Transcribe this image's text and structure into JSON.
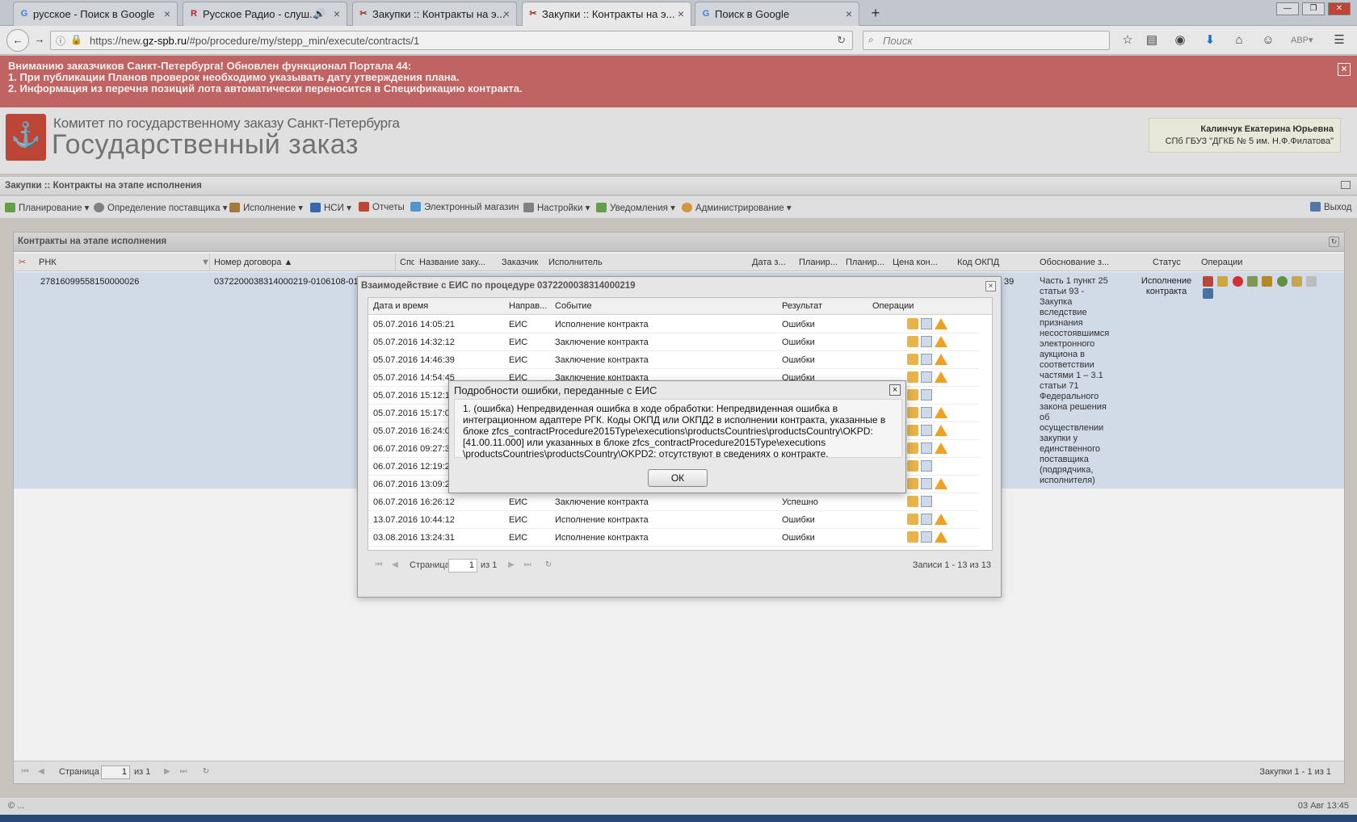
{
  "browser": {
    "tabs": [
      {
        "title": "русское - Поиск в Google",
        "favicon": "G"
      },
      {
        "title": "Русское Радио - слуш...",
        "favicon": "R"
      },
      {
        "title": "Закупки :: Контракты на э...",
        "favicon": "✂"
      },
      {
        "title": "Закупки :: Контракты на э...",
        "favicon": "✂"
      },
      {
        "title": "Поиск в Google",
        "favicon": "G"
      }
    ],
    "url_prefix": "https://new.",
    "url_domain": "gz-spb.ru",
    "url_path": "/#po/procedure/my/stepp_min/execute/contracts/1",
    "search_placeholder": "Поиск"
  },
  "notice": {
    "line1": "Вниманию заказчиков Санкт-Петербурга! Обновлен функционал Портала 44:",
    "line2": "1. При публикации Планов проверок необходимо указывать дату утверждения плана.",
    "line3": "2. Информация из перечня позиций лота автоматически переносится в Спецификацию контракта."
  },
  "header": {
    "org": "Комитет по государственному заказу Санкт-Петербурга",
    "title": "Государственный заказ",
    "user_name": "Калинчук Екатерина Юрьевна",
    "user_org": "СПб ГБУЗ \"ДГКБ № 5 им. Н.Ф.Филатова\""
  },
  "module_title": "Закупки :: Контракты на этапе исполнения",
  "menu": {
    "planning": "Планирование",
    "supplier": "Определение поставщика",
    "execution": "Исполнение",
    "nsi": "НСИ",
    "reports": "Отчеты",
    "eshop": "Электронный магазин",
    "settings": "Настройки",
    "notifications": "Уведомления",
    "admin": "Администрирование",
    "exit": "Выход"
  },
  "panel": {
    "title": "Контракты на этапе исполнения",
    "columns": [
      "РНК",
      "Номер договора",
      "Спо",
      "Название заку...",
      "Заказчик",
      "Исполнитель",
      "Дата з...",
      "Планир...",
      "Планир...",
      "Цена кон...",
      "Код ОКПД",
      "Обоснование з...",
      "Статус",
      "Операции"
    ],
    "row": {
      "rnk": "27816099558150000026",
      "number": "0372200038314000219-0106108-01",
      "okpd_tail": "39",
      "basis": "Часть 1 пункт 25 статьи 93 - Закупка вследствие признания несостоявшимся электронного аукциона в соответствии частями 1 – 3.1 статьи 71 Федерального закона решения об осуществлении закупки у единственного поставщика (подрядчика, исполнителя)",
      "status": "Исполнение контракта"
    },
    "pager": {
      "page_label": "Страница",
      "page": "1",
      "of": "из 1",
      "summary": "Закупки 1 - 1 из 1"
    }
  },
  "eis_window": {
    "title": "Взаимодействие с ЕИС по процедуре 0372200038314000219",
    "columns": [
      "Дата и время",
      "Направ...",
      "Событие",
      "Результат",
      "Операции"
    ],
    "rows": [
      {
        "dt": "05.07.2016 14:05:21",
        "dir": "ЕИС",
        "event": "Исполнение контракта",
        "result": "Ошибки",
        "warn": true
      },
      {
        "dt": "05.07.2016 14:32:12",
        "dir": "ЕИС",
        "event": "Заключение контракта",
        "result": "Ошибки",
        "warn": true
      },
      {
        "dt": "05.07.2016 14:46:39",
        "dir": "ЕИС",
        "event": "Заключение контракта",
        "result": "Ошибки",
        "warn": true
      },
      {
        "dt": "05.07.2016 14:54:45",
        "dir": "ЕИС",
        "event": "Заключение контракта",
        "result": "Ошибки",
        "warn": true
      },
      {
        "dt": "05.07.2016 15:12:10",
        "dir": "",
        "event": "",
        "result": "",
        "warn": false
      },
      {
        "dt": "05.07.2016 15:17:00",
        "dir": "",
        "event": "",
        "result": "",
        "warn": true
      },
      {
        "dt": "05.07.2016 16:24:00",
        "dir": "",
        "event": "",
        "result": "",
        "warn": true
      },
      {
        "dt": "06.07.2016 09:27:30",
        "dir": "",
        "event": "",
        "result": "",
        "warn": true
      },
      {
        "dt": "06.07.2016 12:19:20",
        "dir": "",
        "event": "",
        "result": "",
        "warn": false
      },
      {
        "dt": "06.07.2016 13:09:20",
        "dir": "",
        "event": "",
        "result": "",
        "warn": true
      },
      {
        "dt": "06.07.2016 16:26:12",
        "dir": "ЕИС",
        "event": "Заключение контракта",
        "result": "Успешно",
        "warn": false
      },
      {
        "dt": "13.07.2016 10:44:12",
        "dir": "ЕИС",
        "event": "Исполнение контракта",
        "result": "Ошибки",
        "warn": true
      },
      {
        "dt": "03.08.2016 13:24:31",
        "dir": "ЕИС",
        "event": "Исполнение контракта",
        "result": "Ошибки",
        "warn": true
      }
    ],
    "pager": {
      "page_label": "Страница",
      "page": "1",
      "of": "из 1",
      "summary": "Записи 1 - 13 из 13"
    }
  },
  "error_dialog": {
    "title": "Подробности ошибки, переданные с ЕИС",
    "line1": "1. (ошибка) Непредвиденная ошибка в ходе обработки: Непредвиденная ошибка в",
    "line2": "интеграционном адаптере РГК. Коды ОКПД или ОКПД2 в исполнении контракта, указанные в",
    "line3": "блоке zfcs_contractProcedure2015Type\\executions\\productsCountries\\productsCountry\\OKPD:",
    "line4": "[41.00.11.000] или указанных в блоке zfcs_contractProcedure2015Type\\executions",
    "line5": "\\productsCountries\\productsCountry\\OKPD2: отсутствуют в сведениях о контракте.",
    "ok": "ОК"
  },
  "statusbar": {
    "left": "© ...",
    "right": "03 Авг 13:45"
  }
}
